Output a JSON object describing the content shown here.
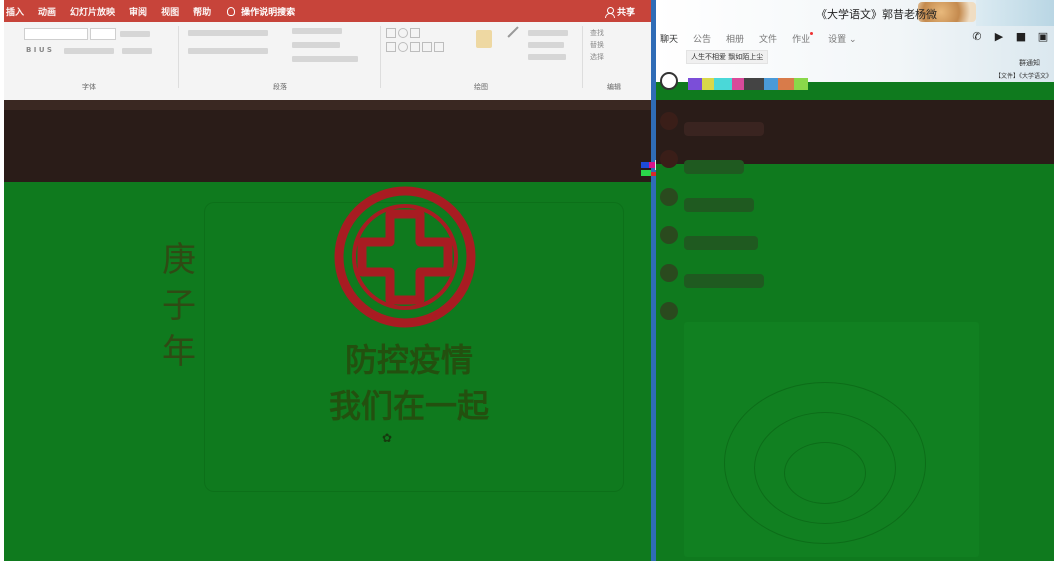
{
  "ppt": {
    "tabs": [
      "插入",
      "动画",
      "幻灯片放映",
      "审阅",
      "视图",
      "帮助"
    ],
    "tell_me": "操作说明搜索",
    "share_label": "共享",
    "ribbon": {
      "font_group": "字体",
      "paragraph_group": "段落",
      "drawing_group": "绘图",
      "editing_group": "编辑",
      "find": "查找",
      "replace": "替换",
      "select": "选择"
    },
    "slide": {
      "side_text": "庚子年",
      "title_line1": "防控疫情",
      "title_line2": "我们在一起"
    }
  },
  "qq": {
    "group_title": "《大学语文》郭昔老杨微",
    "tabs": [
      "聊天",
      "公告",
      "相册",
      "文件",
      "作业",
      "设置"
    ],
    "announcement": "人生不相爱 飘如陌上尘",
    "notice": "群通知",
    "files_label": "【文件】《大学语文》"
  },
  "colors": {
    "ppt_titlebar": "#c7443a",
    "slide_green": "#0f7a1e",
    "divider_blue": "#2f6cb6",
    "emblem_red": "#a81c22"
  }
}
